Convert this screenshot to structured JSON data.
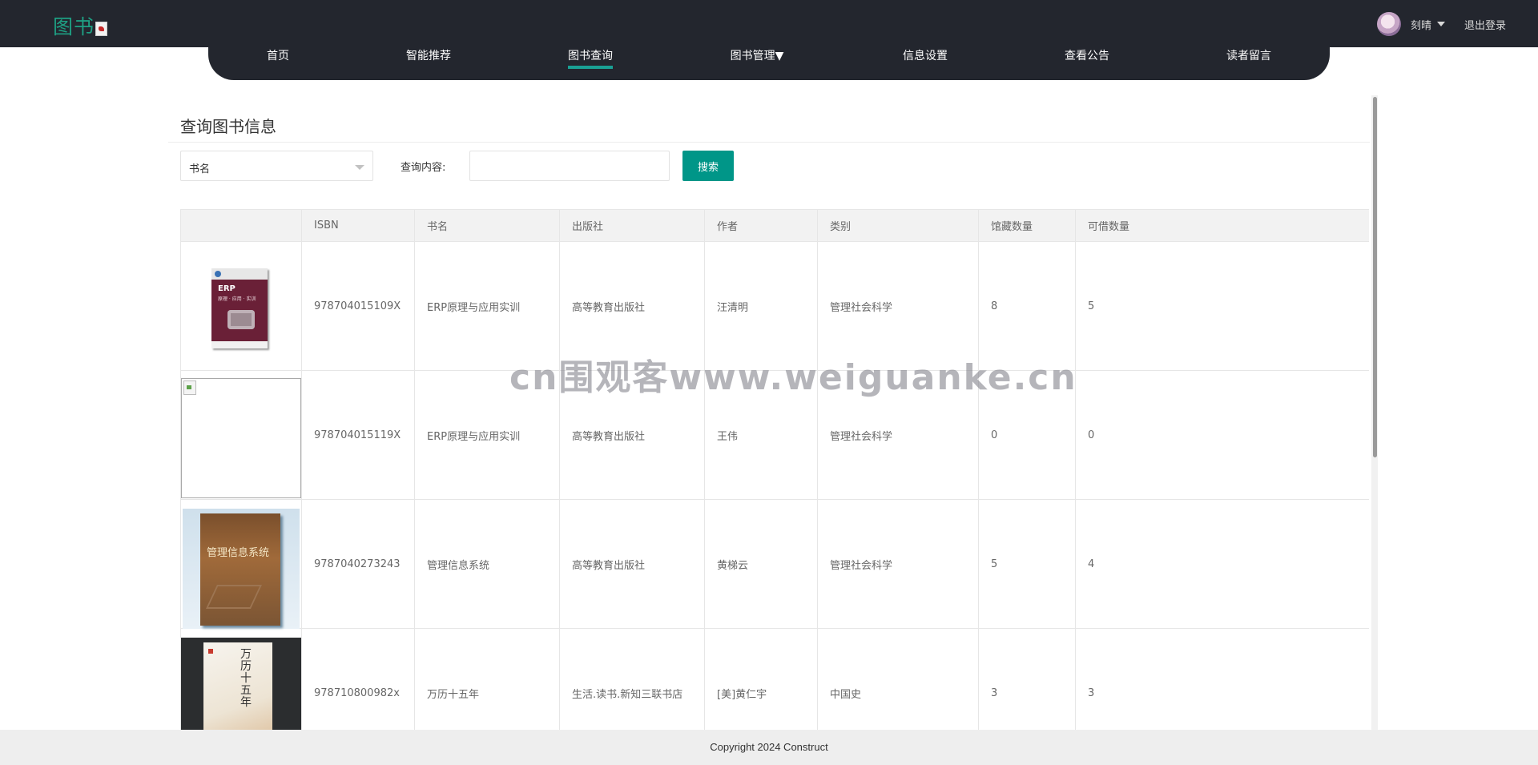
{
  "header": {
    "brand": "图书",
    "nav": [
      {
        "label": "首页",
        "active": false
      },
      {
        "label": "智能推荐",
        "active": false
      },
      {
        "label": "图书查询",
        "active": true
      },
      {
        "label": "图书管理▼",
        "active": false
      },
      {
        "label": "信息设置",
        "active": false
      },
      {
        "label": "查看公告",
        "active": false
      },
      {
        "label": "读者留言",
        "active": false
      }
    ],
    "user": {
      "name": "刻晴",
      "logout_label": "退出登录"
    }
  },
  "search": {
    "title": "查询图书信息",
    "field_select": "书名",
    "query_label": "查询内容:",
    "query_value": "",
    "button_label": "搜索"
  },
  "table": {
    "columns": [
      "",
      "ISBN",
      "书名",
      "出版社",
      "作者",
      "类别",
      "馆藏数量",
      "可借数量"
    ],
    "rows": [
      {
        "cover": "erp-cover",
        "isbn": "978704015109X",
        "title": "ERP原理与应用实训",
        "publisher": "高等教育出版社",
        "author": "汪清明",
        "category": "管理社会科学",
        "stock": "8",
        "available": "5"
      },
      {
        "cover": "broken-image",
        "isbn": "978704015119X",
        "title": "ERP原理与应用实训",
        "publisher": "高等教育出版社",
        "author": "王伟",
        "category": "管理社会科学",
        "stock": "0",
        "available": "0"
      },
      {
        "cover": "mis-cover",
        "isbn": "9787040273243",
        "title": "管理信息系统",
        "publisher": "高等教育出版社",
        "author": "黄梯云",
        "category": "管理社会科学",
        "stock": "5",
        "available": "4"
      },
      {
        "cover": "wanli-cover",
        "isbn": "978710800982x",
        "title": "万历十五年",
        "publisher": "生活.读书.新知三联书店",
        "author": "[美]黄仁宇",
        "category": "中国史",
        "stock": "3",
        "available": "3"
      }
    ]
  },
  "covers": {
    "erp_title": "ERP",
    "erp_subtitle": "原理 · 应用 · 实训",
    "mis_title": "管理信息系统",
    "wanli_title": "万历十五年"
  },
  "watermark": "cn围观客www.weiguanke.cn",
  "footer": {
    "text": "Copyright 2024 Construct"
  },
  "colors": {
    "header_bg": "#23262e",
    "accent": "#009688",
    "brand": "#1e9f83"
  }
}
